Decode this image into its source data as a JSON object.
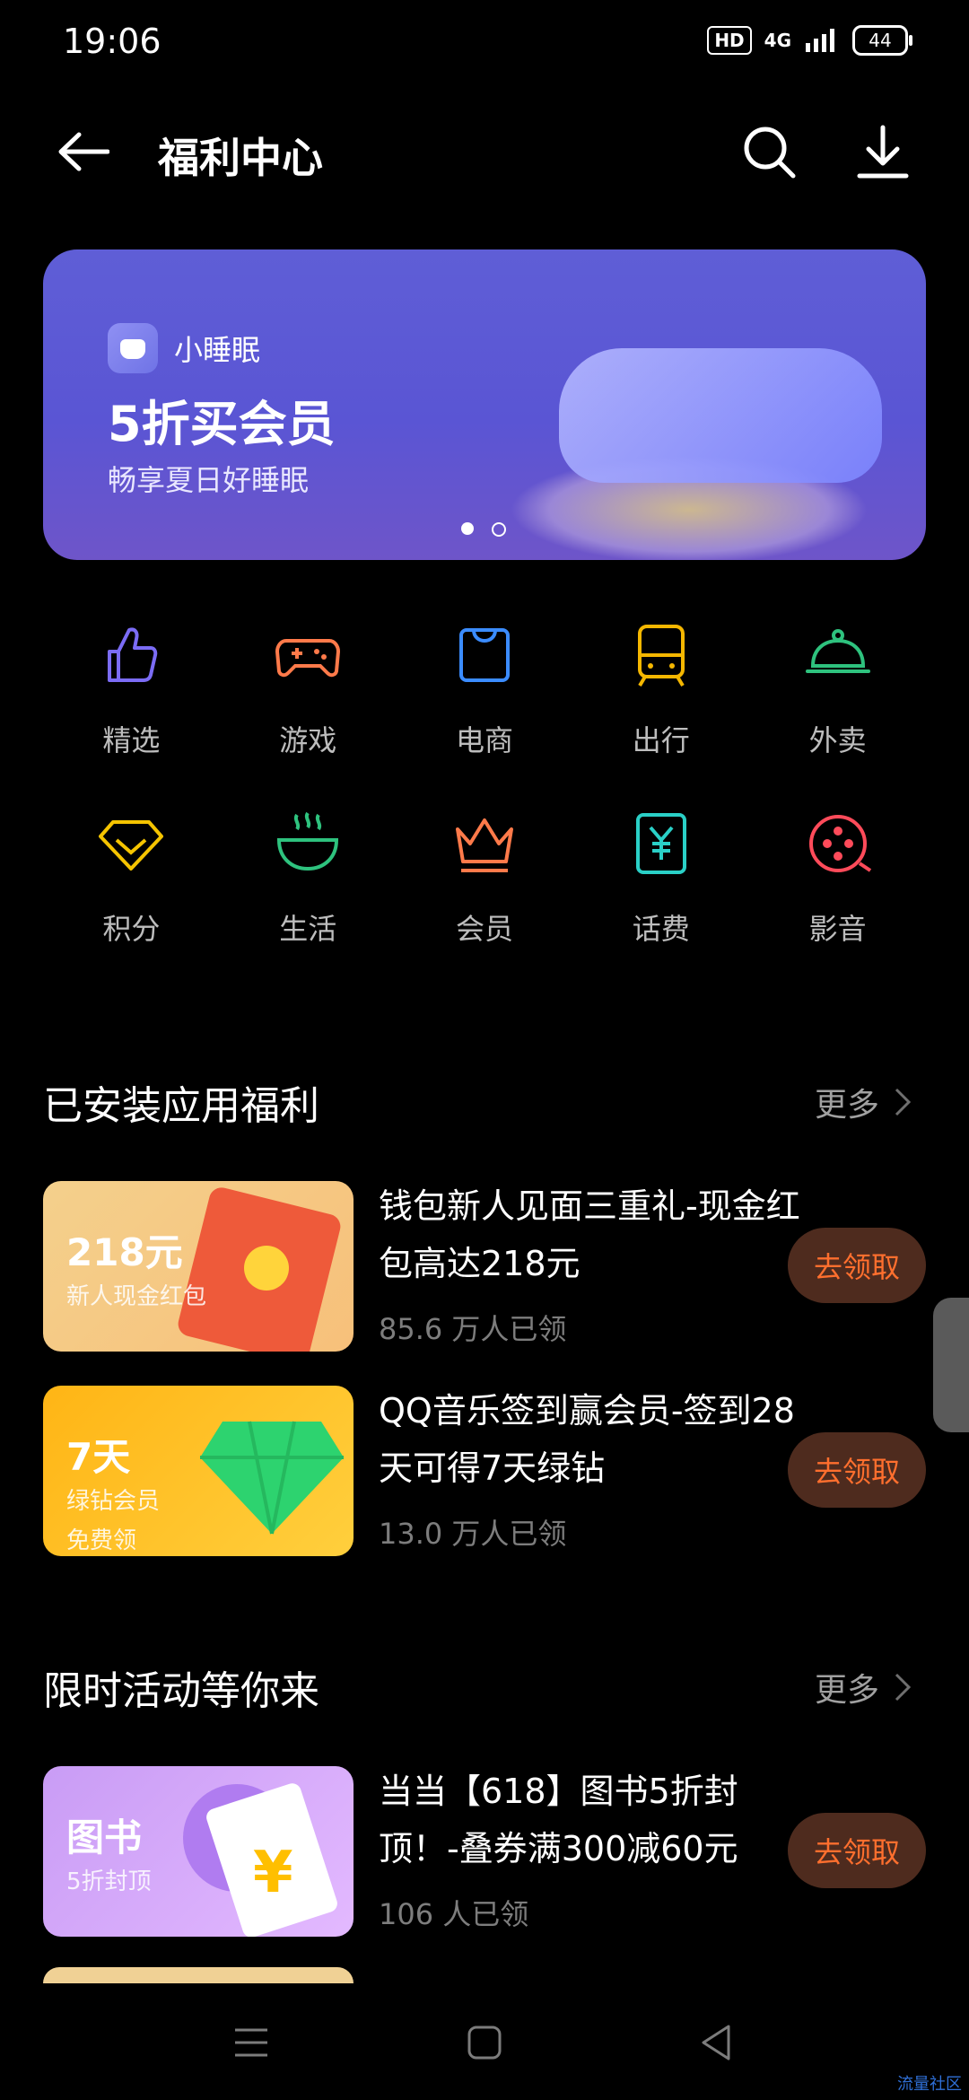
{
  "status_bar": {
    "time": "19:06",
    "hd": "HD",
    "network": "4G",
    "battery": "44"
  },
  "header": {
    "title": "福利中心"
  },
  "banner": {
    "app_name": "小睡眠",
    "headline": "5折买会员",
    "subtitle": "畅享夏日好睡眠",
    "page_count": 2,
    "active_page": 1,
    "colors": {
      "bg": "#5b5ad6"
    }
  },
  "categories": [
    {
      "label": "精选",
      "icon": "thumbs-up-icon",
      "color": "#7b6cf5"
    },
    {
      "label": "游戏",
      "icon": "gamepad-icon",
      "color": "#ff7a4a"
    },
    {
      "label": "电商",
      "icon": "shopping-bag-icon",
      "color": "#3b8cff"
    },
    {
      "label": "出行",
      "icon": "bus-icon",
      "color": "#f5b700"
    },
    {
      "label": "外卖",
      "icon": "food-dome-icon",
      "color": "#2ec27e"
    },
    {
      "label": "积分",
      "icon": "gem-icon",
      "color": "#f5c400"
    },
    {
      "label": "生活",
      "icon": "bowl-icon",
      "color": "#2ec27e"
    },
    {
      "label": "会员",
      "icon": "crown-icon",
      "color": "#ff7a4a"
    },
    {
      "label": "话费",
      "icon": "yuan-card-icon",
      "color": "#2ad0c7"
    },
    {
      "label": "影音",
      "icon": "film-reel-icon",
      "color": "#ff4b5a"
    }
  ],
  "installed_section": {
    "title": "已安装应用福利",
    "more": "更多",
    "items": [
      {
        "thumb_big": "218元",
        "thumb_small": "新人现金红包",
        "thumb_small2": "",
        "thumb_colors": [
          "#f4d08c",
          "#f7c07a"
        ],
        "text": "钱包新人见面三重礼-现金红包高达218元",
        "claimed": "85.6 万人已领",
        "button": "去领取"
      },
      {
        "thumb_big": "7天",
        "thumb_small": "绿钻会员",
        "thumb_small2": "免费领",
        "thumb_colors": [
          "#ffb515",
          "#ffcf3d"
        ],
        "text": "QQ音乐签到赢会员-签到28天可得7天绿钻",
        "claimed": "13.0 万人已领",
        "button": "去领取"
      }
    ]
  },
  "promo_section": {
    "title": "限时活动等你来",
    "more": "更多",
    "items": [
      {
        "thumb_big": "图书",
        "thumb_small": "5折封顶",
        "thumb_small2": "",
        "thumb_colors": [
          "#c99cf5",
          "#e3b9ff"
        ],
        "text": "当当【618】图书5折封顶！-叠券满300减60元",
        "claimed": "106 人已领",
        "button": "去领取"
      }
    ]
  },
  "watermark": "流量社区"
}
